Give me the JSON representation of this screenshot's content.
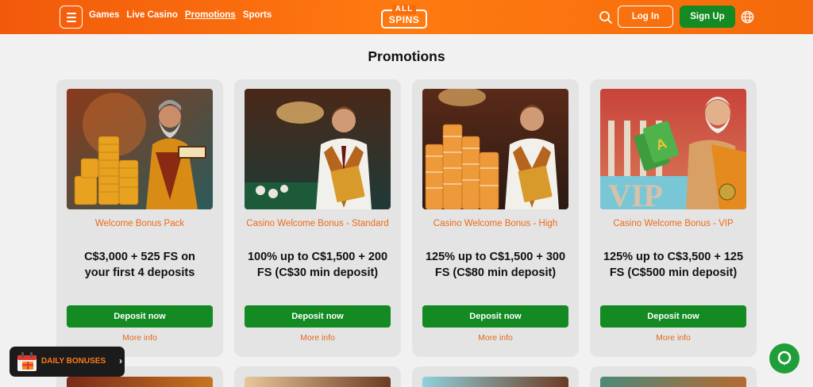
{
  "header": {
    "nav": [
      "Games",
      "Live Casino",
      "Promotions",
      "Sports"
    ],
    "active_nav": "Promotions",
    "logo_top": "ALL",
    "logo_bottom": "SPINS",
    "login_label": "Log In",
    "signup_label": "Sign Up"
  },
  "page_title": "Promotions",
  "promotions": [
    {
      "name": "Welcome Bonus Pack",
      "offer": "C$3,000 + 525 FS on your first 4 deposits",
      "deposit_label": "Deposit now",
      "more_label": "More info"
    },
    {
      "name": "Casino Welcome Bonus - Standard",
      "offer": "100% up to C$1,500 + 200 FS (C$30 min deposit)",
      "deposit_label": "Deposit now",
      "more_label": "More info"
    },
    {
      "name": "Casino Welcome Bonus - High",
      "offer": "125% up to C$1,500 + 300 FS (C$80 min deposit)",
      "deposit_label": "Deposit now",
      "more_label": "More info"
    },
    {
      "name": "Casino Welcome Bonus - VIP",
      "offer": "125% up to C$3,500 + 125 FS (C$500 min deposit)",
      "deposit_label": "Deposit now",
      "more_label": "More info"
    }
  ],
  "daily_bonuses_label": "DAILY BONUSES",
  "colors": {
    "header_orange": "#f46a0c",
    "brand_green": "#138a22",
    "accent_orange": "#ef6a16",
    "card_bg": "#e4e4e4",
    "page_bg": "#f1f1f1"
  },
  "icons": [
    "menu-icon",
    "search-icon",
    "globe-icon",
    "gift-calendar-icon",
    "chevron-right-icon",
    "chat-icon"
  ]
}
